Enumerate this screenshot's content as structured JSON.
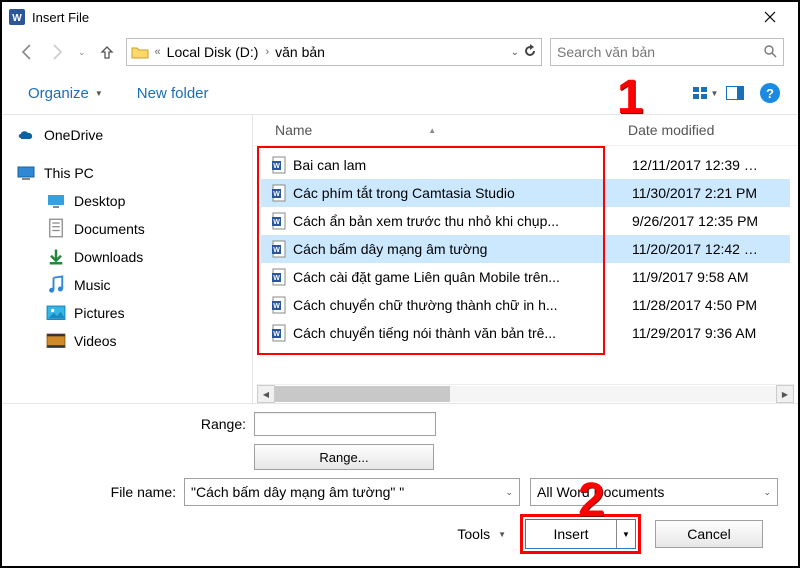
{
  "titlebar": {
    "title": "Insert File"
  },
  "address": {
    "crumbs": [
      "Local Disk (D:)",
      "văn bản"
    ],
    "search_placeholder": "Search văn bản"
  },
  "commands": {
    "organize": "Organize",
    "newfolder": "New folder",
    "help": "?"
  },
  "sidebar": [
    {
      "label": "OneDrive",
      "icon": "onedrive",
      "indent": false
    },
    {
      "label": "This PC",
      "icon": "thispc",
      "indent": false
    },
    {
      "label": "Desktop",
      "icon": "desktop",
      "indent": true
    },
    {
      "label": "Documents",
      "icon": "documents",
      "indent": true
    },
    {
      "label": "Downloads",
      "icon": "downloads",
      "indent": true
    },
    {
      "label": "Music",
      "icon": "music",
      "indent": true
    },
    {
      "label": "Pictures",
      "icon": "pictures",
      "indent": true
    },
    {
      "label": "Videos",
      "icon": "videos",
      "indent": true
    }
  ],
  "columns": {
    "name": "Name",
    "date": "Date modified"
  },
  "files": [
    {
      "name": "Bai can lam",
      "date": "12/11/2017 12:39 …",
      "selected": false
    },
    {
      "name": "Các phím tắt trong Camtasia Studio",
      "date": "11/30/2017 2:21 PM",
      "selected": true
    },
    {
      "name": "Cách ẩn bản xem trước thu nhỏ khi chụp...",
      "date": "9/26/2017 12:35 PM",
      "selected": false
    },
    {
      "name": "Cách bấm dây mạng âm tường",
      "date": "11/20/2017 12:42 …",
      "selected": true
    },
    {
      "name": "Cách cài đặt game Liên quân Mobile trên...",
      "date": "11/9/2017 9:58 AM",
      "selected": false
    },
    {
      "name": "Cách chuyển chữ thường thành chữ in h...",
      "date": "11/28/2017 4:50 PM",
      "selected": false
    },
    {
      "name": "Cách chuyển tiếng nói thành văn bản trê...",
      "date": "11/29/2017 9:36 AM",
      "selected": false
    }
  ],
  "bottom": {
    "range_label": "Range:",
    "range_button": "Range...",
    "filename_label": "File name:",
    "filename_value": "\"Cách bấm dây mạng âm tường\" \"",
    "filetype_value": "All Word Documents",
    "tools_label": "Tools",
    "insert": "Insert",
    "cancel": "Cancel"
  },
  "annotations": {
    "one": "1",
    "two": "2"
  }
}
